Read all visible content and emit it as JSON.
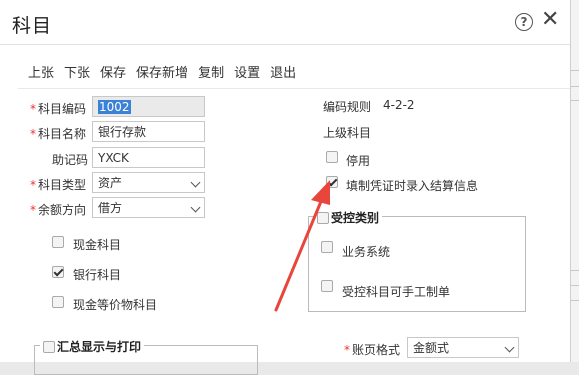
{
  "window": {
    "title": "科目"
  },
  "toolbar": {
    "items": [
      "上张",
      "下张",
      "保存",
      "保存新增",
      "复制",
      "设置",
      "退出"
    ]
  },
  "form": {
    "code_label": "科目编码",
    "code_value": "1002",
    "name_label": "科目名称",
    "name_value": "银行存款",
    "mnemonic_label": "助记码",
    "mnemonic_value": "YXCK",
    "type_label": "科目类型",
    "type_value": "资产",
    "direction_label": "余额方向",
    "direction_value": "借方",
    "cash_label": "现金科目",
    "bank_label": "银行科目",
    "cash_eq_label": "现金等价物科目",
    "rule_label": "编码规则",
    "rule_value": "4-2-2",
    "parent_label": "上级科目",
    "disabled_label": "停用",
    "settle_label": "填制凭证时录入结算信息",
    "controlled_legend": "受控类别",
    "business_label": "业务系统",
    "manual_label": "受控科目可手工制单",
    "summary_legend": "汇总显示与打印",
    "ledger_format_label": "账页格式",
    "ledger_format_value": "金额式"
  },
  "state": {
    "cash_checked": false,
    "bank_checked": true,
    "cash_eq_checked": false,
    "disabled_checked": false,
    "settle_checked": true,
    "business_checked": false,
    "manual_checked": false
  },
  "annotation": {
    "arrow_color": "#e8453c"
  }
}
